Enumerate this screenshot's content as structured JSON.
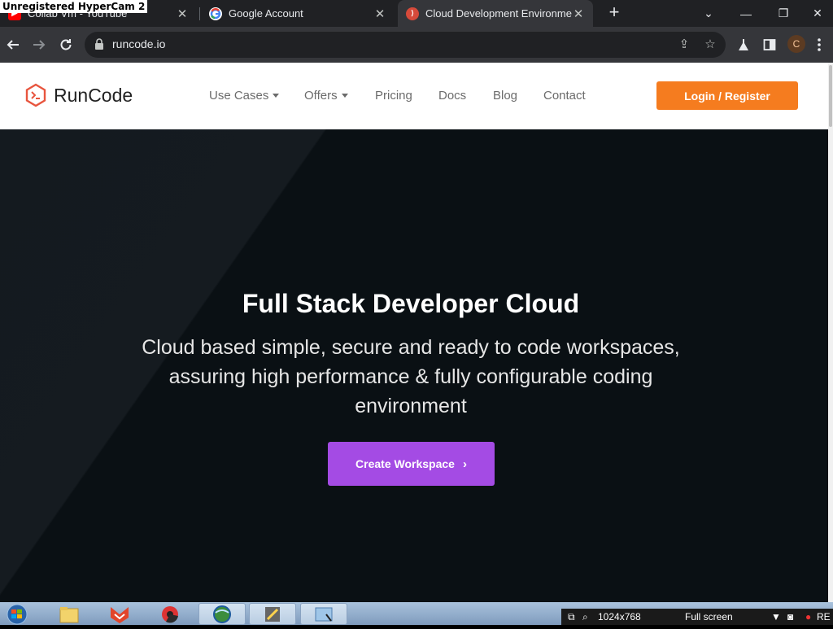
{
  "watermark": "Unregistered HyperCam 2",
  "tabs": [
    {
      "title": "Collab Vm - YouTube",
      "favicon": "youtube-icon"
    },
    {
      "title": "Google Account",
      "favicon": "google-icon"
    },
    {
      "title": "Cloud Development Environment",
      "favicon": "runcode-icon",
      "active": true
    }
  ],
  "address_bar": {
    "url": "runcode.io"
  },
  "profile_initial": "C",
  "site": {
    "brand": "RunCode",
    "nav": [
      {
        "label": "Use Cases",
        "dropdown": true
      },
      {
        "label": "Offers",
        "dropdown": true
      },
      {
        "label": "Pricing"
      },
      {
        "label": "Docs"
      },
      {
        "label": "Blog"
      },
      {
        "label": "Contact"
      }
    ],
    "login_label": "Login / Register"
  },
  "hero": {
    "title": "Full Stack Developer Cloud",
    "subtitle_lines": [
      "Cloud based simple, secure and ready to code workspaces,",
      "assuring high performance & fully configurable coding",
      "environment"
    ],
    "cta_label": "Create Workspace"
  },
  "recorder": {
    "resolution": "1024x768",
    "mode": "Full screen",
    "status": "RE"
  },
  "colors": {
    "accent_orange": "#f57c1f",
    "cta_purple": "#a44be4",
    "hero_bg": "#0a1014"
  }
}
